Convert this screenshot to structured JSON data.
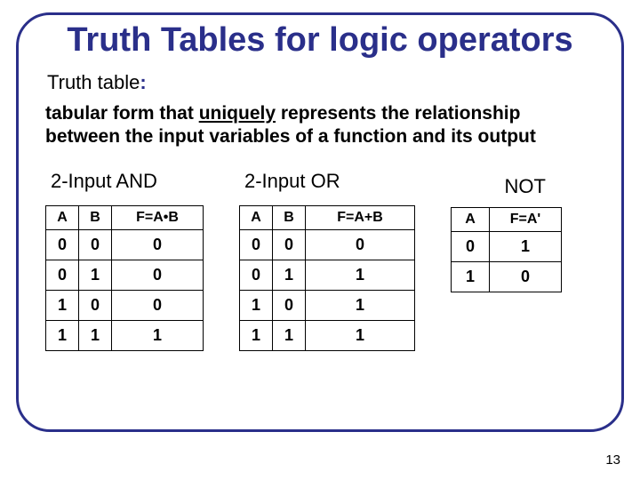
{
  "title": "Truth Tables for logic operators",
  "subhead_label": "Truth table",
  "subhead_colon": ":",
  "body_pre": "tabular form that ",
  "body_underlined": "uniquely",
  "body_post": " represents the relationship between the input variables of a function and its output",
  "and": {
    "caption": "2-Input AND",
    "h0": "A",
    "h1": "B",
    "h2": "F=A•B",
    "r0c0": "0",
    "r0c1": "0",
    "r0c2": "0",
    "r1c0": "0",
    "r1c1": "1",
    "r1c2": "0",
    "r2c0": "1",
    "r2c1": "0",
    "r2c2": "0",
    "r3c0": "1",
    "r3c1": "1",
    "r3c2": "1"
  },
  "or": {
    "caption": "2-Input OR",
    "h0": "A",
    "h1": "B",
    "h2": "F=A+B",
    "r0c0": "0",
    "r0c1": "0",
    "r0c2": "0",
    "r1c0": "0",
    "r1c1": "1",
    "r1c2": "1",
    "r2c0": "1",
    "r2c1": "0",
    "r2c2": "1",
    "r3c0": "1",
    "r3c1": "1",
    "r3c2": "1"
  },
  "not": {
    "caption": "NOT",
    "h0": "A",
    "h1": "F=A'",
    "r0c0": "0",
    "r0c1": "1",
    "r1c0": "1",
    "r1c1": "0"
  },
  "page_number": "13",
  "chart_data": [
    {
      "type": "table",
      "title": "2-Input AND",
      "columns": [
        "A",
        "B",
        "F=A•B"
      ],
      "rows": [
        [
          0,
          0,
          0
        ],
        [
          0,
          1,
          0
        ],
        [
          1,
          0,
          0
        ],
        [
          1,
          1,
          1
        ]
      ]
    },
    {
      "type": "table",
      "title": "2-Input OR",
      "columns": [
        "A",
        "B",
        "F=A+B"
      ],
      "rows": [
        [
          0,
          0,
          0
        ],
        [
          0,
          1,
          1
        ],
        [
          1,
          0,
          1
        ],
        [
          1,
          1,
          1
        ]
      ]
    },
    {
      "type": "table",
      "title": "NOT",
      "columns": [
        "A",
        "F=A'"
      ],
      "rows": [
        [
          0,
          1
        ],
        [
          1,
          0
        ]
      ]
    }
  ]
}
